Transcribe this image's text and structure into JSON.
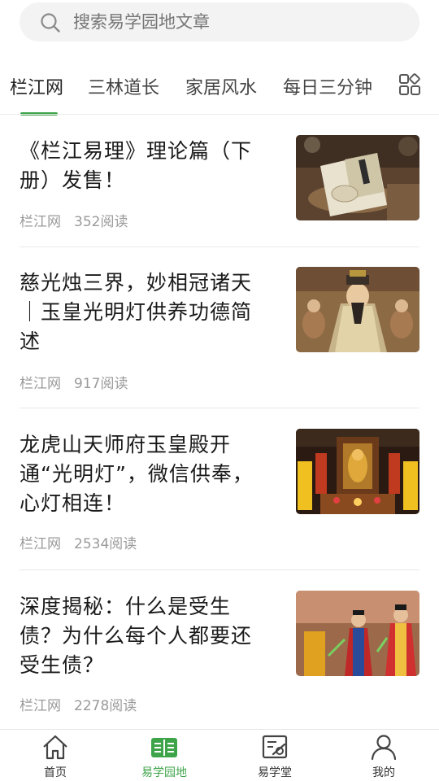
{
  "search": {
    "placeholder": "搜索易学园地文章",
    "icon": "search-icon"
  },
  "tabs": [
    {
      "label": "栏江网",
      "active": true
    },
    {
      "label": "三林道长",
      "active": false
    },
    {
      "label": "家居风水",
      "active": false
    },
    {
      "label": "每日三分钟",
      "active": false
    }
  ],
  "tabs_more_icon": "grid-icon",
  "articles": [
    {
      "title": "《栏江易理》理论篇（下册）发售！",
      "source": "栏江网",
      "views": "352阅读",
      "thumb": "book-photo"
    },
    {
      "title": "慈光烛三界，妙相冠诸天｜玉皇光明灯供养功德简述",
      "source": "栏江网",
      "views": "917阅读",
      "thumb": "jade-emperor-painting"
    },
    {
      "title": "龙虎山天师府玉皇殿开通“光明灯”，微信供奉，心灯相连！",
      "source": "栏江网",
      "views": "2534阅读",
      "thumb": "temple-hall-photo"
    },
    {
      "title": "深度揭秘：什么是受生债？为什么每个人都要还受生债？",
      "source": "栏江网",
      "views": "2278阅读",
      "thumb": "priests-ritual-photo"
    }
  ],
  "bottom_nav": [
    {
      "label": "首页",
      "icon": "home-icon",
      "active": false
    },
    {
      "label": "易学园地",
      "icon": "book-list-icon",
      "active": true
    },
    {
      "label": "易学堂",
      "icon": "classroom-icon",
      "active": false
    },
    {
      "label": "我的",
      "icon": "user-icon",
      "active": false
    }
  ],
  "colors": {
    "accent": "#3ea44a",
    "text": "#1a1a1a",
    "muted": "#9a9a9a",
    "search_bg": "#f3f3f3"
  }
}
